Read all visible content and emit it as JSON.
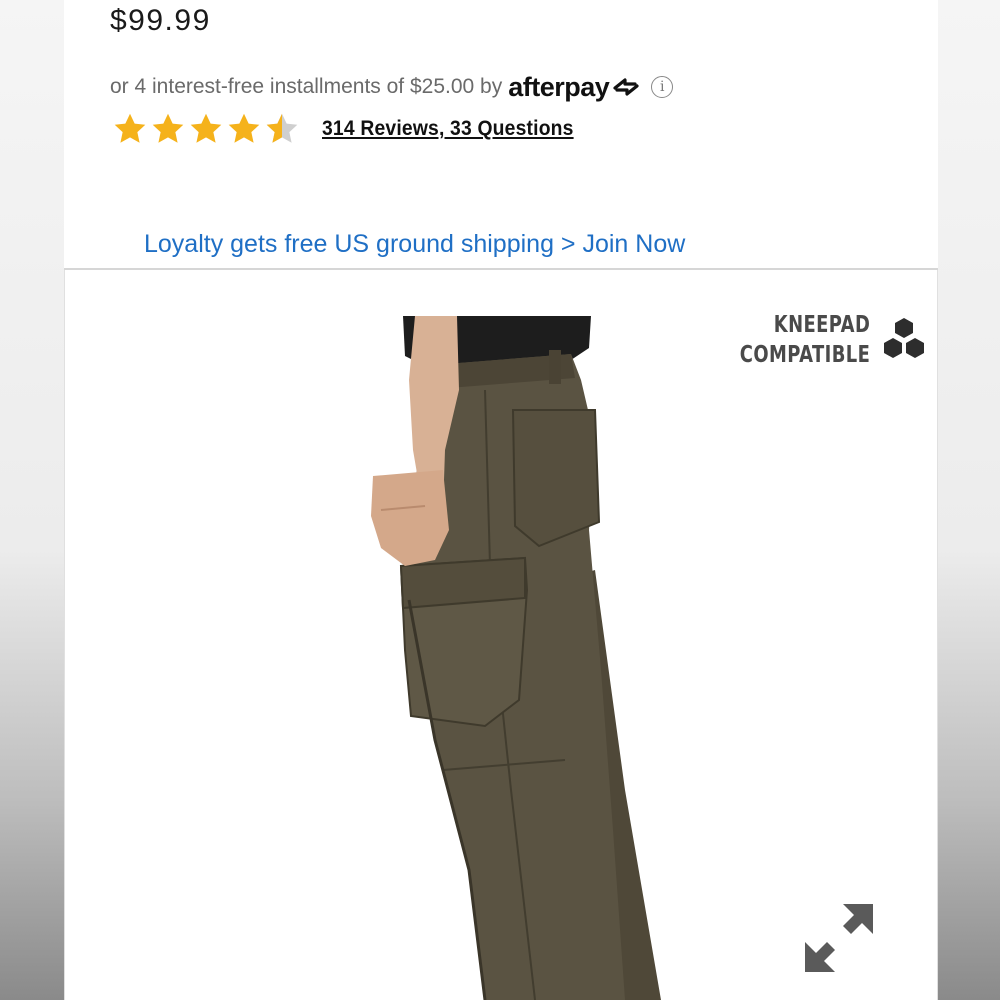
{
  "product": {
    "price": "$99.99",
    "installments_text": "or 4 interest-free installments of $25.00 by",
    "afterpay_brand": "afterpay",
    "info_icon_glyph": "i",
    "rating": {
      "value": 4.5,
      "max": 5
    },
    "reviews_link": "314 Reviews, 33 Questions",
    "loyalty_link": "Loyalty gets free US ground shipping > Join Now",
    "badge": {
      "line1": "KNEEPAD",
      "line2": "COMPATIBLE",
      "icon": "hexagon-cluster-icon"
    },
    "expand_icon": "expand-arrows-icon"
  },
  "colors": {
    "star": "#f5b21b",
    "star_empty": "#cfcfcf",
    "link_blue": "#1f6fc5",
    "pants": "#5a5342"
  }
}
